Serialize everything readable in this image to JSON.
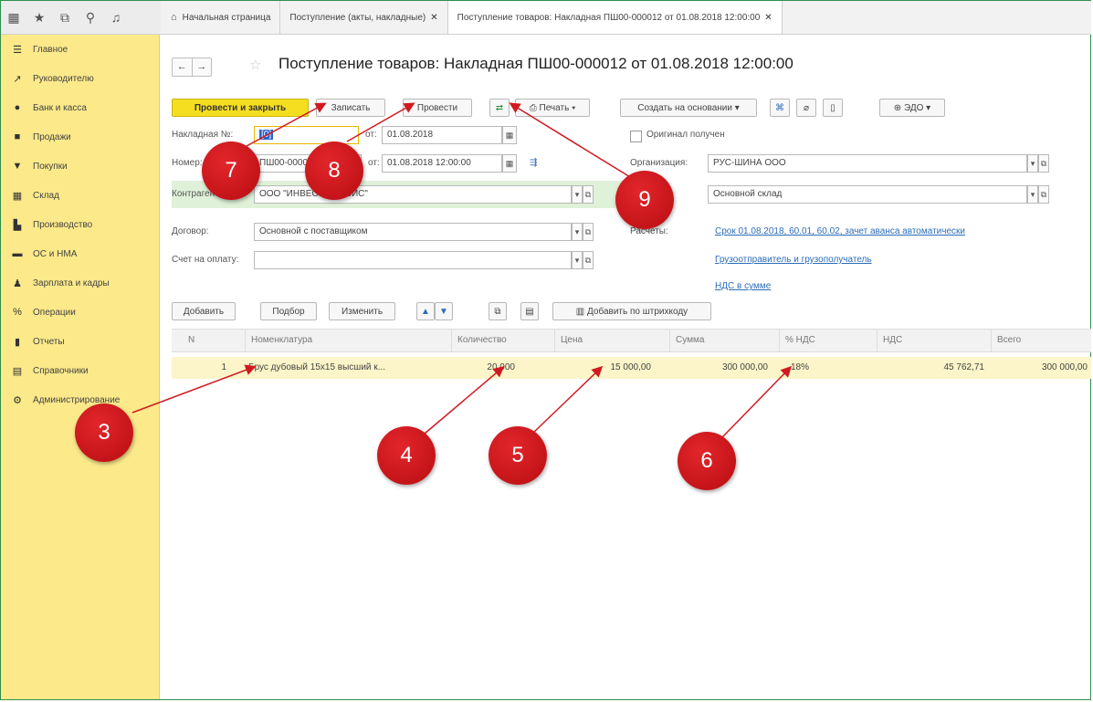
{
  "topbar": {
    "icons": [
      "apps-icon",
      "star-icon",
      "history-icon",
      "search-icon",
      "bell-icon"
    ],
    "tabs": [
      {
        "label": "Начальная страница",
        "closable": false,
        "home": true
      },
      {
        "label": "Поступление (акты, накладные)",
        "closable": true
      },
      {
        "label": "Поступление товаров: Накладная ПШ00-000012 от 01.08.2018 12:00:00",
        "closable": true,
        "active": true
      }
    ]
  },
  "sidebar": {
    "items": [
      {
        "label": "Главное",
        "icon": "☰"
      },
      {
        "label": "Руководителю",
        "icon": "↗"
      },
      {
        "label": "Банк и касса",
        "icon": "●"
      },
      {
        "label": "Продажи",
        "icon": "■"
      },
      {
        "label": "Покупки",
        "icon": "▼"
      },
      {
        "label": "Склад",
        "icon": "▦"
      },
      {
        "label": "Производство",
        "icon": "▙"
      },
      {
        "label": "ОС и НМА",
        "icon": "▬"
      },
      {
        "label": "Зарплата и кадры",
        "icon": "♟"
      },
      {
        "label": "Операции",
        "icon": "%"
      },
      {
        "label": "Отчеты",
        "icon": "▮"
      },
      {
        "label": "Справочники",
        "icon": "▤"
      },
      {
        "label": "Администрирование",
        "icon": "⚙"
      }
    ]
  },
  "header": {
    "back": "←",
    "forward": "→",
    "title": "Поступление товаров: Накладная ПШ00-000012 от 01.08.2018 12:00:00"
  },
  "toolbar": {
    "post_close": "Провести и закрыть",
    "save": "Записать",
    "post": "Провести",
    "print": "Печать",
    "create_based": "Создать на основании",
    "edo": "ЭДО"
  },
  "form": {
    "invoice_label": "Накладная №:",
    "invoice_value": "[0]",
    "from_label": "от:",
    "date_value": "01.08.2018",
    "original_label": "Оригинал получен",
    "number_label": "Номер:",
    "number_value": "ПШ00-000012",
    "datetime_label": "от:",
    "datetime_value": "01.08.2018 12:00:00",
    "org_label": "Организация:",
    "org_value": "РУС-ШИНА ООО",
    "contractor_label": "Контрагент:",
    "contractor_value": "ООО \"ИНВЕСТ-СЕРВИС\"",
    "warehouse_value": "Основной склад",
    "contract_label": "Договор:",
    "contract_value": "Основной с поставщиком",
    "settlements_label": "Расчеты:",
    "settlements_link": "Срок 01.08.2018, 60.01, 60.02, зачет аванса автоматически",
    "payment_label": "Счет на оплату:",
    "consignor_link": "Грузоотправитель и грузополучатель",
    "vat_link": "НДС в сумме"
  },
  "tabletoolbar": {
    "add": "Добавить",
    "pick": "Подбор",
    "change": "Изменить",
    "barcode": "Добавить по штрихкоду"
  },
  "table": {
    "headers": [
      "N",
      "Номенклатура",
      "Количество",
      "Цена",
      "Сумма",
      "% НДС",
      "НДС",
      "Всего"
    ],
    "rows": [
      [
        "1",
        "Брус дубовый 15х15 высший к...",
        "20,000",
        "15 000,00",
        "300 000,00",
        "18%",
        "45 762,71",
        "300 000,00"
      ]
    ]
  },
  "badges": [
    "3",
    "4",
    "5",
    "6",
    "7",
    "8",
    "9"
  ],
  "colors": {
    "sidebar": "#fbe98a",
    "primary_button": "#f5de1f",
    "badge": "#c8161b",
    "link": "#2b6cb8"
  }
}
